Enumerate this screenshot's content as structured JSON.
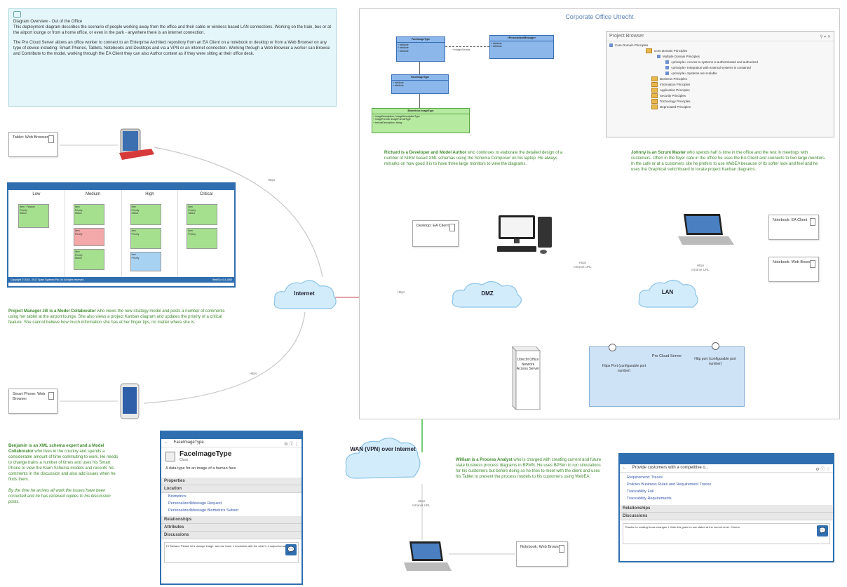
{
  "note": {
    "title": "Diagram Overview - Out of the Office",
    "para1": "This deployment diagram describes the scenario of people working away from the office and their cable or wireless based LAN connections. Working on the train, bus or at the airport lounge or from a home office, or even in the park - anywhere there is an internet connection.",
    "para2": "The Pro Cloud Server allows an office worker to connect to an Enterprise Architect repository from an EA Client on a notebook or desktop or from a Web Browser on any type of device including: Smart Phones, Tablets, Notebooks and Desktops and via a VPN or an internet connection. Working through a Web Browser a worker can Browse and Contribute to the model, working through the EA Client they can also Author content as if they were sitting at their office desk."
  },
  "region_title": "Corporate Office Utrecht",
  "nodes": {
    "tablet": "Tablet: Web Browser",
    "smartphone": "Smart Phone: Web Browser",
    "desktop": "Desktop: EA Client",
    "notebook_ea": "Notebook: EA Client",
    "notebook_web": "Notebook: Web Browser",
    "notebook_wan": "Notebook: Web Browser",
    "firewall": "Utrecht Office Network Access Server",
    "pcs_title": "Pro Cloud Server",
    "pcs_port1": "Https Port (configurable port number)",
    "pcs_port2": "Http port (configurable port number)"
  },
  "clouds": {
    "internet": "Internet",
    "dmz": "DMZ",
    "lan": "LAN",
    "wan": "WAN (VPN) over Internet"
  },
  "connectors": {
    "https1": "Https",
    "https2": "Https",
    "https3": "Https",
    "https4": "Https Intranet URL",
    "https5": "Https Intranet URL",
    "https6": "Https Intranet URL"
  },
  "stories": {
    "jill_name": "Project Manager Jill is a Model Collaborator",
    "jill_text": " who views the new strategy model and posts a number of comments using her tablet at the airport lounge. She also views a project Kanban diagram and updates the priority of a critical feature. She cannot believe how much information she has at her finger tips, no matter where she is.",
    "benjamin_name": "Benjamin is an XML schema expert and a Model Collaborator",
    "benjamin_text": " who lives in the country and spends a considerable amount of time commuting to work. He needs to change trains a number of times and uses his Smart Phone to view the Kiam Schema models and records his comments in the discussion and also add issues when he finds them.",
    "benjamin_text2": "By the time he arrives all work the issues have been corrected and he has received replies to his discussion posts.",
    "richard_name": "Richard is a Developer and Model Author",
    "richard_text": " who continues to elaborate the detailed design of a number of NIEM based XML schemas using the Schema Composer on his laptop. He always remarks on how good it is to have three large monitors to view the diagrams.",
    "johnny_name": "Johnny is an Scrum Master",
    "johnny_text": " who spends half is time in the office and the rest in meetings with customers. Often in the foyer cafe in the office he uses the EA Client and connects to two large monitors. In the cafe or at a customers site he prefers to use WebEA because of its softer look and feel and he uses the Graphical switchboard to locate project Kanban diagrams.",
    "william_name": "William is a Process Analyst",
    "william_text": " who is charged with creating current and future state business process diagrams in BPMN. He uses BPSim to run simulations for his customers but before doing so he tries to meet with the client and uses his Tablet to present the process models to his customers using WebEA."
  },
  "kanban": {
    "columns": [
      "Low",
      "Medium",
      "High",
      "Critical"
    ],
    "footer_left": "Copyright © 2018 - 2017 Sparx Systems Pty Ltd. All rights reserved.",
    "footer_right": "WebEA v1.4.1808"
  },
  "project_browser": {
    "title": "Project Browser",
    "root": "Core Domain Principles",
    "items": [
      "Core Domain Principles",
      "Multiple Domain Principles",
      "«principle» Access to systems is authenticated and authorized",
      "«principle» Integration with external systems is contained",
      "«principle» Systems are scalable",
      "Business Principles",
      "Information Principles",
      "Application Principles",
      "Security Principles",
      "Technology Principles",
      "Deprecated Principles"
    ]
  },
  "face_window": {
    "nav_title": "FaceImageType",
    "heading": "FaceImageType",
    "subtitle": "Class",
    "description": "A data type for an image of a human face",
    "sections": [
      "Properties",
      "Location",
      "Relationships",
      "Attributes",
      "Discussions"
    ],
    "location_links": [
      "Biometrics",
      "PersonalizedMessage Request",
      "PersonalizedMessage Biometrics Subset"
    ],
    "comment_text": "Hi Richard. Please let's change image, and are there 1 resolution with the other's 1 output format."
  },
  "provide_window": {
    "nav_title": "Provide customers with a competitive o...",
    "links": [
      "Requirement: Traces",
      "Policies Business Rules and Requirement Traces",
      "Traceability Full",
      "Traceability Requirements"
    ],
    "sections": [
      "Relationships",
      "Discussions"
    ],
    "comment_text": "Thanks for making those changes, I think this goes in now stated at the current level. Cheers."
  },
  "schema_classes": {
    "c1": "FaceImageType",
    "c2": "«PersonalizedMessage»",
    "c3": "FaceImageType",
    "c4": "Biometrics ImageType",
    "assoc_label": "+ImageDetails"
  },
  "colors": {
    "note_bg": "#e4f6f9",
    "story_green": "#3f8a2d",
    "region_title": "#5b83b5",
    "cloud_fill": "#d3ecfb",
    "pcs_fill": "#cfe3f7",
    "window_blue": "#2f6fb0",
    "link_red": "#d9848a",
    "link_green": "#3bb53b"
  }
}
